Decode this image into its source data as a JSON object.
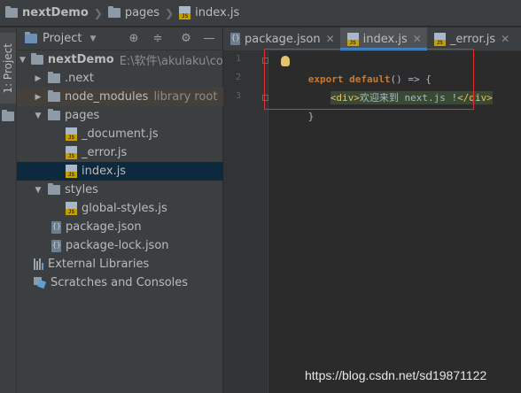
{
  "breadcrumb": {
    "items": [
      {
        "label": "nextDemo",
        "icon": "folder-icon"
      },
      {
        "label": "pages",
        "icon": "folder-icon"
      },
      {
        "label": "index.js",
        "icon": "js-file-icon"
      }
    ]
  },
  "left_strip": {
    "project_tab_label": "1: Project"
  },
  "project_panel": {
    "title": "Project",
    "toolbar_icons": [
      "target-icon",
      "collapse-icon",
      "gear-icon",
      "minimize-icon"
    ],
    "tree": [
      {
        "label": "nextDemo",
        "hint": "E:\\软件\\akulaku\\code",
        "expanded": true
      },
      {
        "label": ".next",
        "hint": "",
        "expanded": false
      },
      {
        "label": "node_modules",
        "hint": "library root",
        "expanded": false
      },
      {
        "label": "pages",
        "hint": "",
        "expanded": true
      },
      {
        "label": "_document.js",
        "hint": ""
      },
      {
        "label": "_error.js",
        "hint": ""
      },
      {
        "label": "index.js",
        "hint": "",
        "selected": true
      },
      {
        "label": "styles",
        "hint": "",
        "expanded": true
      },
      {
        "label": "global-styles.js",
        "hint": ""
      },
      {
        "label": "package.json",
        "hint": ""
      },
      {
        "label": "package-lock.json",
        "hint": ""
      },
      {
        "label": "External Libraries",
        "hint": ""
      },
      {
        "label": "Scratches and Consoles",
        "hint": ""
      }
    ]
  },
  "editor": {
    "tabs": [
      {
        "label": "package.json",
        "icon": "json-file-icon",
        "active": false
      },
      {
        "label": "index.js",
        "icon": "js-file-icon",
        "active": true
      },
      {
        "label": "_error.js",
        "icon": "js-file-icon",
        "active": false
      }
    ],
    "line_numbers": [
      "1",
      "2",
      "3"
    ],
    "code": {
      "line1_kw1": "export",
      "line1_kw2": "default",
      "line1_rest": "() => {",
      "line2_open": "<div>",
      "line2_text": "欢迎来到 next.js !",
      "line2_close": "</div>",
      "line3": "}"
    }
  },
  "watermark": "https://blog.csdn.net/sd19871122",
  "colors": {
    "highlight_box": "#e0312d",
    "selection": "#0d293e",
    "active_tab_underline": "#4a88c7",
    "keyword": "#cc7832",
    "tag": "#e8bf6a"
  }
}
